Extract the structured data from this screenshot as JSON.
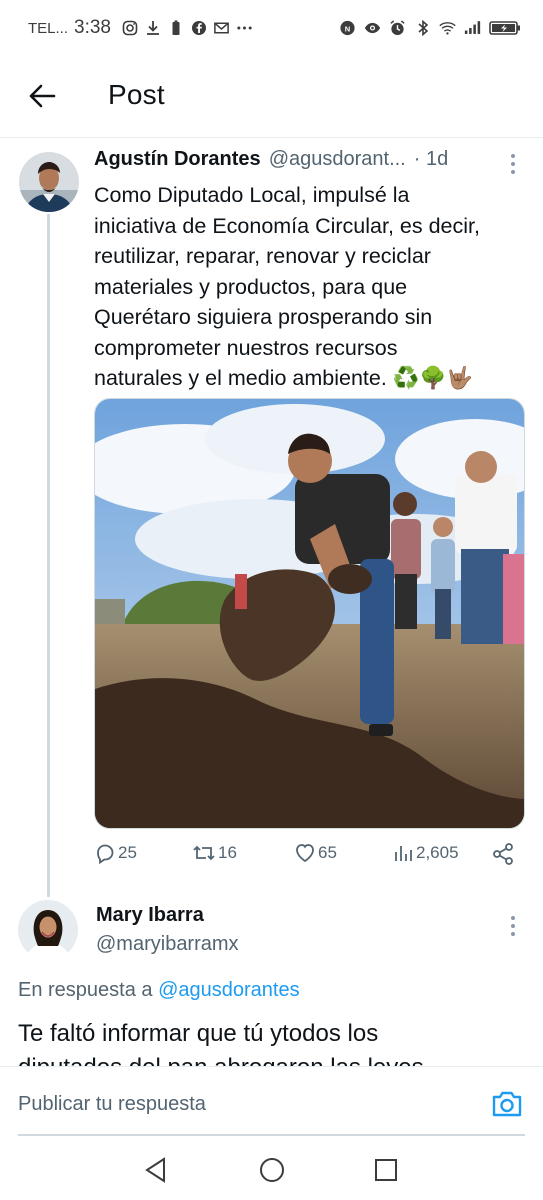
{
  "status_bar": {
    "carrier": "TEL...",
    "time": "3:38"
  },
  "header": {
    "title": "Post",
    "back_icon": "arrow-left-icon"
  },
  "tweet": {
    "author_name": "Agustín Dorantes",
    "author_handle": "@agusdorant...",
    "time_ago": "· 1d",
    "text_lines": [
      "Como Diputado Local, impulsé la",
      "iniciativa de Economía Circular, es decir,",
      "reutilizar, reparar, renovar y reciclar",
      "materiales y productos, para que",
      "Querétaro siguiera prosperando sin",
      "comprometer nuestros recursos",
      "naturales y el medio ambiente. ♻️🌳🤟🏽"
    ],
    "stats": {
      "replies": "25",
      "retweets": "16",
      "likes": "65",
      "views": "2,605"
    }
  },
  "reply": {
    "author_name": "Mary Ibarra",
    "author_handle": "@maryibarramx",
    "in_reply_prefix": "En respuesta a",
    "in_reply_mention": "@agusdorantes",
    "text_line_1": "Te faltó informar que tú ytodos los",
    "text_line_2": "diputados del pan abrogaron las leyes"
  },
  "compose": {
    "placeholder": "Publicar tu respuesta"
  },
  "colors": {
    "accent": "#1d9bf0",
    "secondary_text": "#536471",
    "divider": "#cfd9de"
  }
}
